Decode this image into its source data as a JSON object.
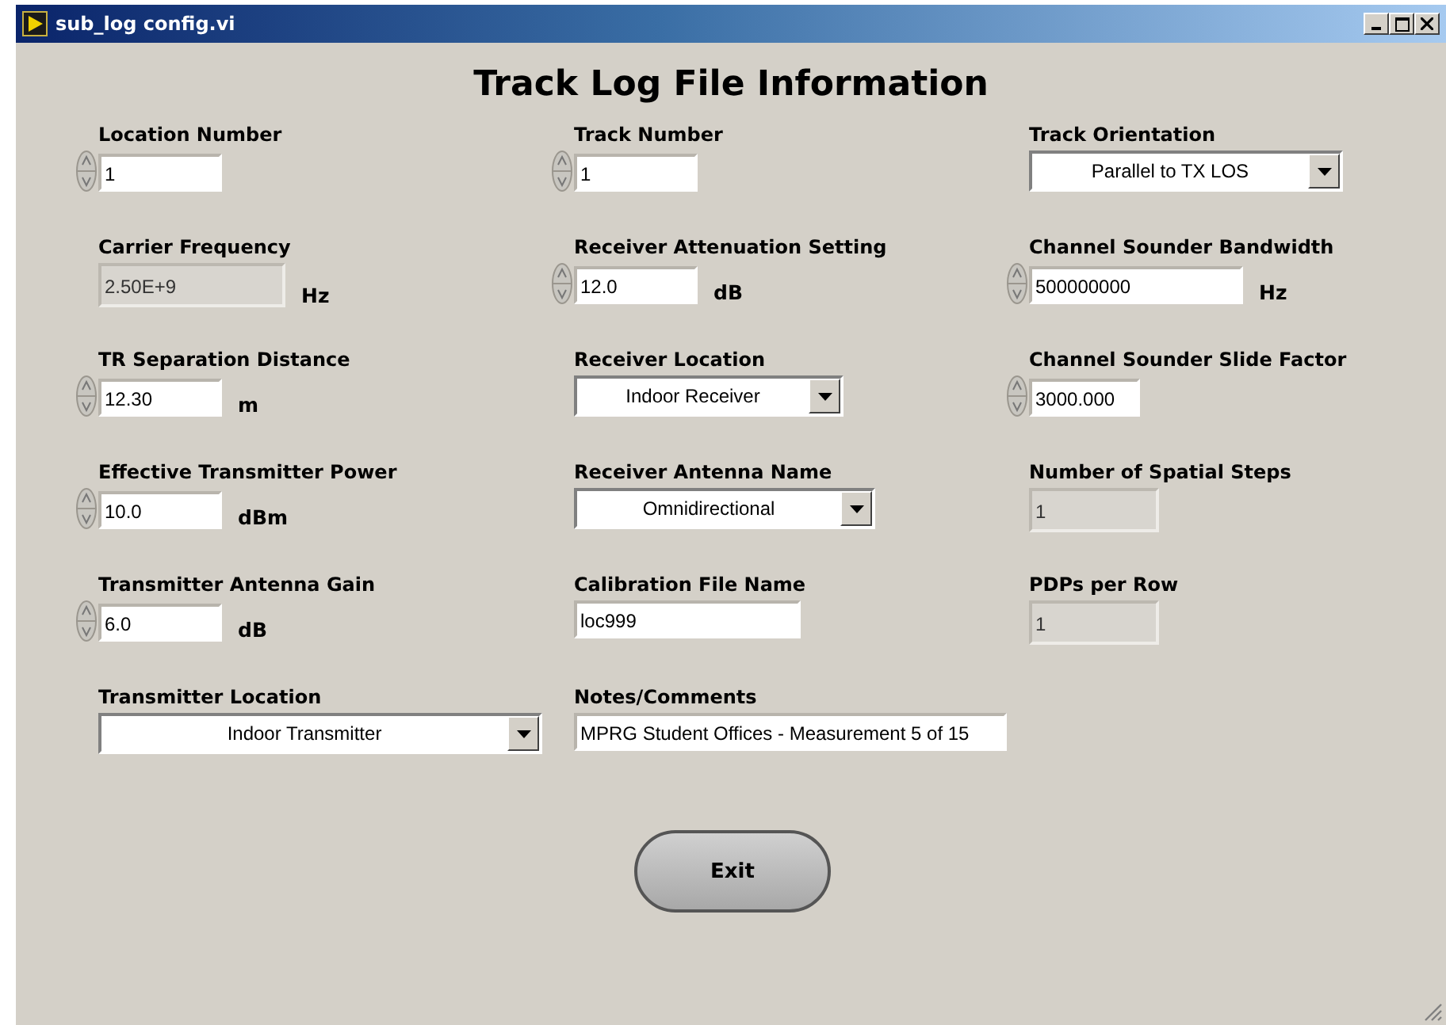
{
  "window": {
    "title": "sub_log config.vi"
  },
  "heading": "Track Log File Information",
  "columns": [
    [
      {
        "kind": "numeric",
        "label": "Location Number",
        "value": "1"
      },
      {
        "kind": "indicator",
        "label": "Carrier Frequency",
        "value": "2.50E+9",
        "unit": "Hz"
      },
      {
        "kind": "numeric",
        "label": "TR Separation Distance",
        "value": "12.30",
        "unit": "m"
      },
      {
        "kind": "numeric",
        "label": "Effective Transmitter Power",
        "value": "10.0",
        "unit": "dBm"
      },
      {
        "kind": "numeric",
        "label": "Transmitter Antenna Gain",
        "value": "6.0",
        "unit": "dB"
      },
      {
        "kind": "ring",
        "label": "Transmitter Location",
        "value": "Indoor Transmitter"
      }
    ],
    [
      {
        "kind": "numeric",
        "label": "Track Number",
        "value": "1"
      },
      {
        "kind": "numeric",
        "label": "Receiver Attenuation Setting",
        "value": "12.0",
        "unit": "dB"
      },
      {
        "kind": "ring",
        "label": "Receiver Location",
        "value": "Indoor Receiver"
      },
      {
        "kind": "ring",
        "label": "Receiver Antenna Name",
        "value": "Omnidirectional"
      },
      {
        "kind": "string",
        "label": "Calibration File Name",
        "value": "loc999"
      },
      {
        "kind": "string",
        "label": "Notes/Comments",
        "value": "MPRG Student Offices - Measurement 5 of 15"
      }
    ],
    [
      {
        "kind": "ring",
        "label": "Track Orientation",
        "value": "Parallel to TX LOS"
      },
      {
        "kind": "numeric",
        "label": "Channel Sounder Bandwidth",
        "value": "500000000",
        "unit": "Hz"
      },
      {
        "kind": "numeric",
        "label": "Channel Sounder Slide Factor",
        "value": "3000.000"
      },
      {
        "kind": "indicator",
        "label": "Number of Spatial Steps",
        "value": "1"
      },
      {
        "kind": "indicator",
        "label": "PDPs per Row",
        "value": "1"
      }
    ]
  ],
  "exit_button": "Exit"
}
